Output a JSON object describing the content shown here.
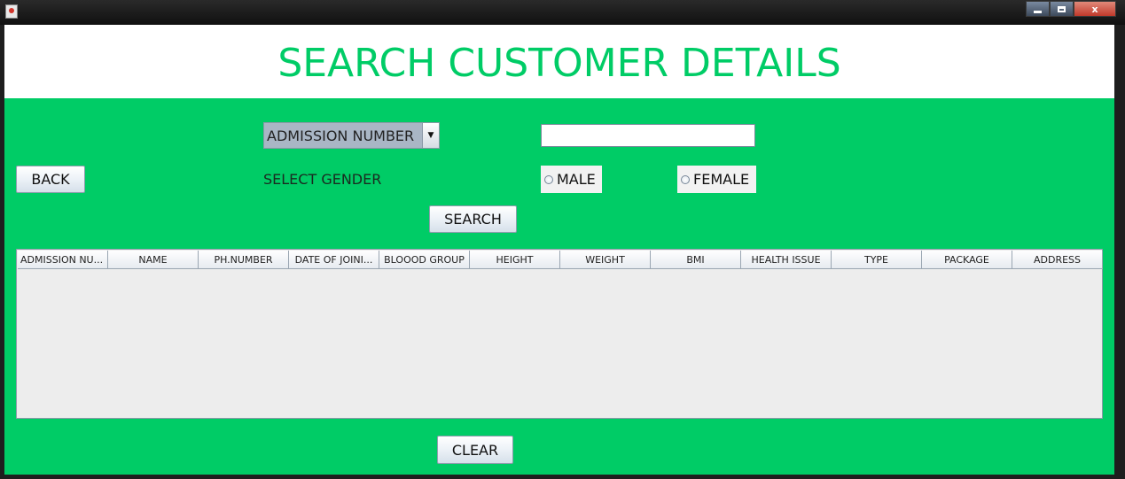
{
  "window": {
    "minimize_glyph": "minimize-icon",
    "maximize_glyph": "maximize-icon",
    "close_label": "x"
  },
  "header": {
    "title": "SEARCH CUSTOMER DETAILS"
  },
  "search": {
    "field_select_value": "ADMISSION NUMBER",
    "query_value": "",
    "search_button_label": "SEARCH"
  },
  "gender": {
    "label": "SELECT GENDER",
    "options": [
      {
        "label": "MALE",
        "selected": false
      },
      {
        "label": "FEMALE",
        "selected": false
      }
    ]
  },
  "buttons": {
    "back_label": "BACK",
    "clear_label": "CLEAR"
  },
  "table": {
    "columns": [
      "ADMISSION NU...",
      "NAME",
      "PH.NUMBER",
      "DATE OF JOINI...",
      "BLOOOD GROUP",
      "HEIGHT",
      "WEIGHT",
      "BMI",
      "HEALTH ISSUE",
      "TYPE",
      "PACKAGE",
      "ADDRESS"
    ],
    "rows": []
  },
  "colors": {
    "accent_green": "#00cc66",
    "header_bg": "#ffffff",
    "table_bg": "#ededed"
  }
}
